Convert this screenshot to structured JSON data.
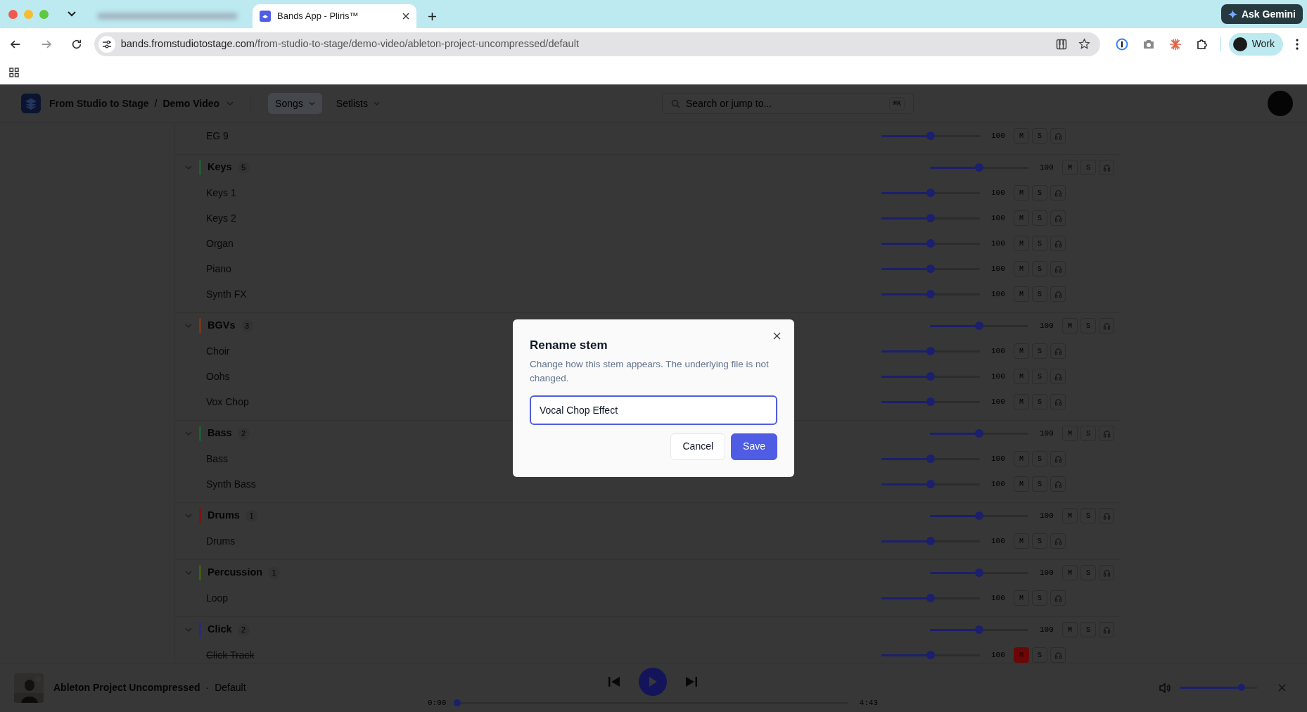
{
  "browser": {
    "tabs": [
      {
        "kind": "blurred",
        "selected": false
      },
      {
        "kind": "tab",
        "title": "Bands App - Pliris™",
        "selected": true
      }
    ],
    "gemini_button": "Ask Gemini",
    "url": {
      "host": "bands.fromstudiotostage.com",
      "path": "/from-studio-to-stage/demo-video/ableton-project-uncompressed/default"
    },
    "profile": "Work"
  },
  "app": {
    "breadcrumb": [
      "From Studio to Stage",
      "Demo Video"
    ],
    "breadcrumb_separator": "/",
    "nav": [
      {
        "label": "Songs",
        "selected": true
      },
      {
        "label": "Setlists",
        "selected": false
      }
    ],
    "search": {
      "placeholder": "Search or jump to...",
      "shortcut": "⌘K"
    }
  },
  "groups": [
    {
      "kind": "continued",
      "stems": [
        {
          "name": "EG 9",
          "level": 0.5,
          "reading": "100",
          "mute_label": "M",
          "solo_label": "S",
          "muted": false
        }
      ]
    },
    {
      "kind": "group",
      "name": "Keys",
      "count": "5",
      "color": "#1f5c33",
      "expanded": true,
      "level": 0.5,
      "reading": "100",
      "mute_label": "M",
      "solo_label": "S",
      "muted": false,
      "stems": [
        {
          "name": "Keys 1",
          "level": 0.5,
          "reading": "100",
          "mute_label": "M",
          "solo_label": "S",
          "muted": false
        },
        {
          "name": "Keys 2",
          "level": 0.5,
          "reading": "100",
          "mute_label": "M",
          "solo_label": "S",
          "muted": false
        },
        {
          "name": "Organ",
          "level": 0.5,
          "reading": "100",
          "mute_label": "M",
          "solo_label": "S",
          "muted": false
        },
        {
          "name": "Piano",
          "level": 0.5,
          "reading": "100",
          "mute_label": "M",
          "solo_label": "S",
          "muted": false
        },
        {
          "name": "Synth FX",
          "level": 0.5,
          "reading": "100",
          "mute_label": "M",
          "solo_label": "S",
          "muted": false
        }
      ]
    },
    {
      "kind": "group",
      "name": "BGVs",
      "count": "3",
      "color": "#7a3418",
      "expanded": true,
      "level": 0.5,
      "reading": "100",
      "mute_label": "M",
      "solo_label": "S",
      "muted": false,
      "stems": [
        {
          "name": "Choir",
          "level": 0.5,
          "reading": "100",
          "mute_label": "M",
          "solo_label": "S",
          "muted": false
        },
        {
          "name": "Oohs",
          "level": 0.5,
          "reading": "100",
          "mute_label": "M",
          "solo_label": "S",
          "muted": false
        },
        {
          "name": "Vox Chop",
          "level": 0.5,
          "reading": "100",
          "mute_label": "M",
          "solo_label": "S",
          "muted": false
        }
      ]
    },
    {
      "kind": "group",
      "name": "Bass",
      "count": "2",
      "color": "#1f5c33",
      "expanded": true,
      "level": 0.5,
      "reading": "100",
      "mute_label": "M",
      "solo_label": "S",
      "muted": false,
      "stems": [
        {
          "name": "Bass",
          "level": 0.5,
          "reading": "100",
          "mute_label": "M",
          "solo_label": "S",
          "muted": false
        },
        {
          "name": "Synth Bass",
          "level": 0.5,
          "reading": "100",
          "mute_label": "M",
          "solo_label": "S",
          "muted": false
        }
      ]
    },
    {
      "kind": "group",
      "name": "Drums",
      "count": "1",
      "color": "#7a1414",
      "expanded": true,
      "level": 0.5,
      "reading": "100",
      "mute_label": "M",
      "solo_label": "S",
      "muted": false,
      "stems": [
        {
          "name": "Drums",
          "level": 0.5,
          "reading": "100",
          "mute_label": "M",
          "solo_label": "S",
          "muted": false
        }
      ]
    },
    {
      "kind": "group",
      "name": "Percussion",
      "count": "1",
      "color": "#3d5c14",
      "expanded": true,
      "level": 0.5,
      "reading": "100",
      "mute_label": "M",
      "solo_label": "S",
      "muted": false,
      "stems": [
        {
          "name": "Loop",
          "level": 0.5,
          "reading": "100",
          "mute_label": "M",
          "solo_label": "S",
          "muted": false
        }
      ]
    },
    {
      "kind": "group",
      "name": "Click",
      "count": "2",
      "color": "#2a2a7a",
      "expanded": true,
      "level": 0.5,
      "reading": "100",
      "mute_label": "M",
      "solo_label": "S",
      "muted": false,
      "stems": [
        {
          "name": "Click Track",
          "level": 0.5,
          "reading": "100",
          "mute_label": "M",
          "solo_label": "S",
          "muted": true
        }
      ]
    }
  ],
  "player": {
    "title": "Ableton Project Uncompressed",
    "separator": "·",
    "version": "Default",
    "elapsed": "0:00",
    "total": "4:43",
    "progress": {
      "level": 0
    },
    "volume": {
      "level": 0.8
    }
  },
  "dialog": {
    "title": "Rename stem",
    "description": "Change how this stem appears. The underlying file is not changed.",
    "value": "Vocal Chop Effect",
    "buttons": [
      {
        "kind": "secondary",
        "label": "Cancel"
      },
      {
        "kind": "primary",
        "label": "Save"
      }
    ]
  }
}
